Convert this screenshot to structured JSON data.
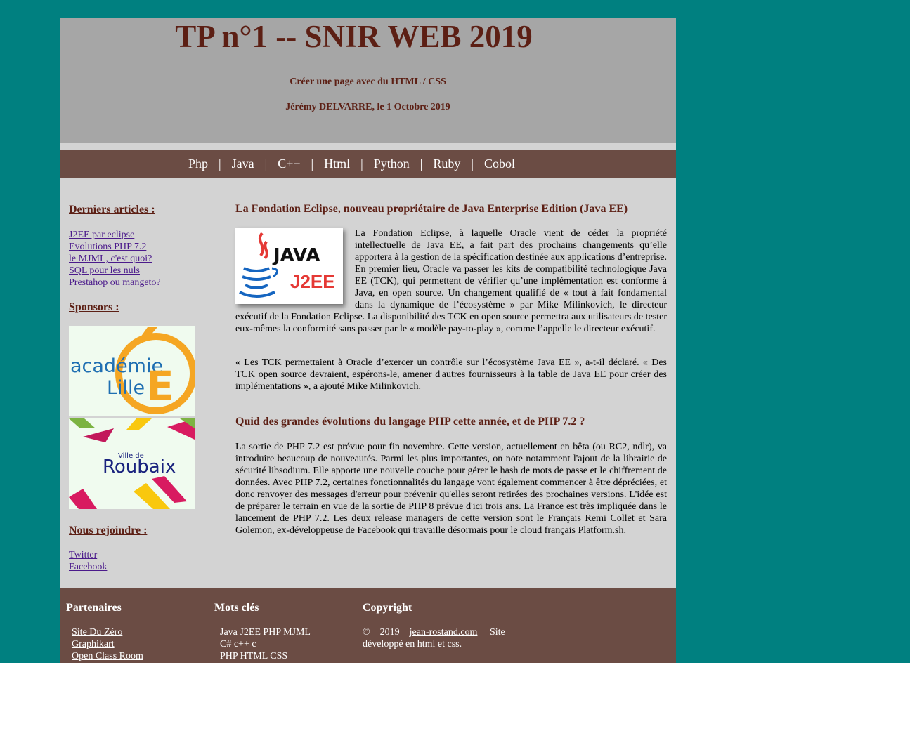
{
  "header": {
    "title": "TP n°1 -- SNIR WEB 2019",
    "subtitle": "Créer une page avec du HTML / CSS",
    "author_line": "Jérémy DELVARRE, le 1 Octobre 2019"
  },
  "nav": {
    "items": [
      "Php",
      "Java",
      "C++",
      "Html",
      "Python",
      "Ruby",
      "Cobol"
    ],
    "separator": "|"
  },
  "sidebar": {
    "articles_title": "Derniers articles :",
    "articles": [
      "J2EE par eclipse",
      "Evolutions PHP 7.2",
      "le MJML, c'est quoi?",
      "SQL pour les nuls",
      "Prestahop ou mangeto?"
    ],
    "sponsors_title": "Sponsors :",
    "sponsor1": {
      "line1": "académie",
      "line2": "Lille",
      "letter": "E"
    },
    "sponsor2": {
      "small": "Ville de",
      "name": "Roubaix"
    },
    "join_title": "Nous rejoindre :",
    "join_links": [
      "Twitter",
      "Facebook"
    ]
  },
  "main": {
    "article1": {
      "title": "La Fondation Eclipse, nouveau propriétaire de Java Enterprise Edition (Java EE)",
      "image_text1": "JAVA",
      "image_text2": "J2EE",
      "paragraph1": "La Fondation Eclipse, à laquelle Oracle vient de céder la propriété intellectuelle de Java EE, a fait part des prochains changements qu’elle apportera à la gestion de la spécification destinée aux applications d’entreprise. En premier lieu, Oracle va passer les kits de compatibilité technologique Java EE (TCK), qui permettent de vérifier qu’une implémentation est conforme à Java, en open source. Un changement qualifié de « tout à fait fondamental dans la dynamique de l’écosystème » par Mike Milinkovich, le directeur exécutif de la Fondation Eclipse. La disponibilité des TCK en open source permettra aux utilisateurs de tester eux-mêmes la conformité sans passer par le « modèle pay-to-play », comme l’appelle le directeur exécutif.",
      "paragraph2": "« Les TCK permettaient à Oracle d’exercer un contrôle sur l’écosystème Java EE », a-t-il déclaré. « Des TCK open source devraient, espérons-le, amener d'autres fournisseurs à la table de Java EE pour créer des implémentations », a ajouté Mike Milinkovich."
    },
    "article2": {
      "title": "Quid des grandes évolutions du langage PHP cette année, et de PHP 7.2 ?",
      "paragraph1": "La sortie de PHP 7.2 est prévue pour fin novembre. Cette version, actuellement en bêta (ou RC2, ndlr), va introduire beaucoup de nouveautés. Parmi les plus importantes, on note notamment l'ajout de la librairie de sécurité libsodium. Elle apporte une nouvelle couche pour gérer le hash de mots de passe et le chiffrement de données. Avec PHP 7.2, certaines fonctionnalités du langage vont également commencer à être dépréciées, et donc renvoyer des messages d'erreur pour prévenir qu'elles seront retirées des prochaines versions. L'idée est de préparer le terrain en vue de la sortie de PHP 8 prévue d'ici trois ans. La France est très impliquée dans le lancement de PHP 7.2. Les deux release managers de cette version sont le Français Remi Collet et Sara Golemon, ex-développeuse de Facebook qui travaille désormais pour le cloud français Platform.sh."
    }
  },
  "footer": {
    "partners_title": "Partenaires",
    "partners": [
      "Site Du Zéro",
      "Graphikart",
      "Open Class Room"
    ],
    "keywords_title": "Mots clés",
    "keywords": [
      "Java J2EE PHP MJML",
      "C# c++ c",
      "PHP HTML CSS"
    ],
    "copyright_title": "Copyright",
    "copyright_prefix": "©    2019",
    "copyright_link": "jean-rostand.com",
    "copyright_suffix": "Site",
    "copyright_line2": "développé en html et css."
  },
  "colors": {
    "background": "#008080",
    "header_bg": "#a6a6a6",
    "nav_bg": "#6b4c44",
    "content_bg": "#d3d3d3",
    "title_color": "#5c1f14",
    "link_color": "#4b1a8b"
  }
}
